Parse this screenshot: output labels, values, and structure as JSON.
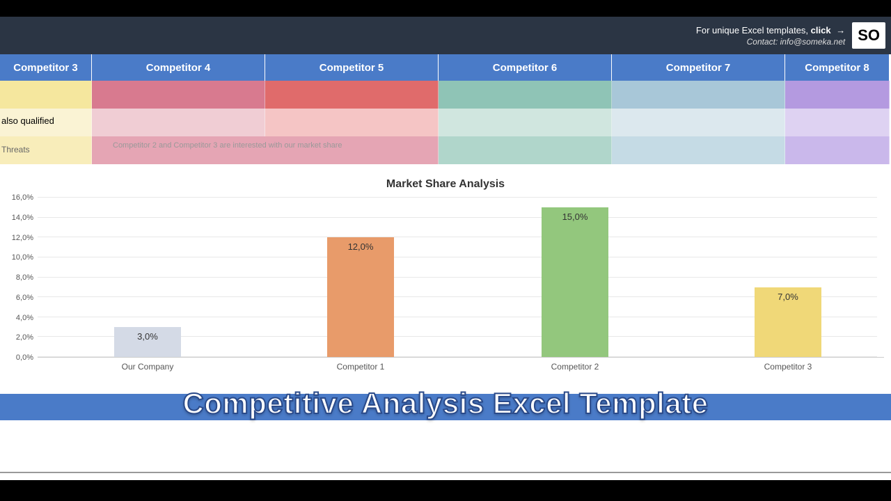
{
  "header": {
    "promo_prefix": "For unique Excel templates, ",
    "promo_action": "click",
    "contact_label": "Contact: ",
    "contact_email": "info@someka.net",
    "logo": "SO"
  },
  "competitor_headers": [
    "Competitor 3",
    "Competitor 4",
    "Competitor 5",
    "Competitor 6",
    "Competitor 7",
    "Competitor 8"
  ],
  "row_texts": {
    "qualified": "also qualified",
    "threats": "Threats",
    "note": "Competitor 2 and Competitor 3 are interested with our market share"
  },
  "overlay_title": "Competitive Analysis Excel Template",
  "chart_data": {
    "type": "bar",
    "title": "Market Share Analysis",
    "categories": [
      "Our Company",
      "Competitor 1",
      "Competitor 2",
      "Competitor 3"
    ],
    "values": [
      3.0,
      12.0,
      15.0,
      7.0
    ],
    "value_labels": [
      "3,0%",
      "12,0%",
      "15,0%",
      "7,0%"
    ],
    "ylabel": "",
    "xlabel": "",
    "ylim": [
      0,
      16
    ],
    "y_ticks": [
      0,
      2,
      4,
      6,
      8,
      10,
      12,
      14,
      16
    ],
    "y_tick_labels": [
      "0,0%",
      "2,0%",
      "4,0%",
      "6,0%",
      "8,0%",
      "10,0%",
      "12,0%",
      "14,0%",
      "16,0%"
    ],
    "colors": [
      "#d4dae6",
      "#e89b6a",
      "#93c77d",
      "#f0d878"
    ]
  }
}
